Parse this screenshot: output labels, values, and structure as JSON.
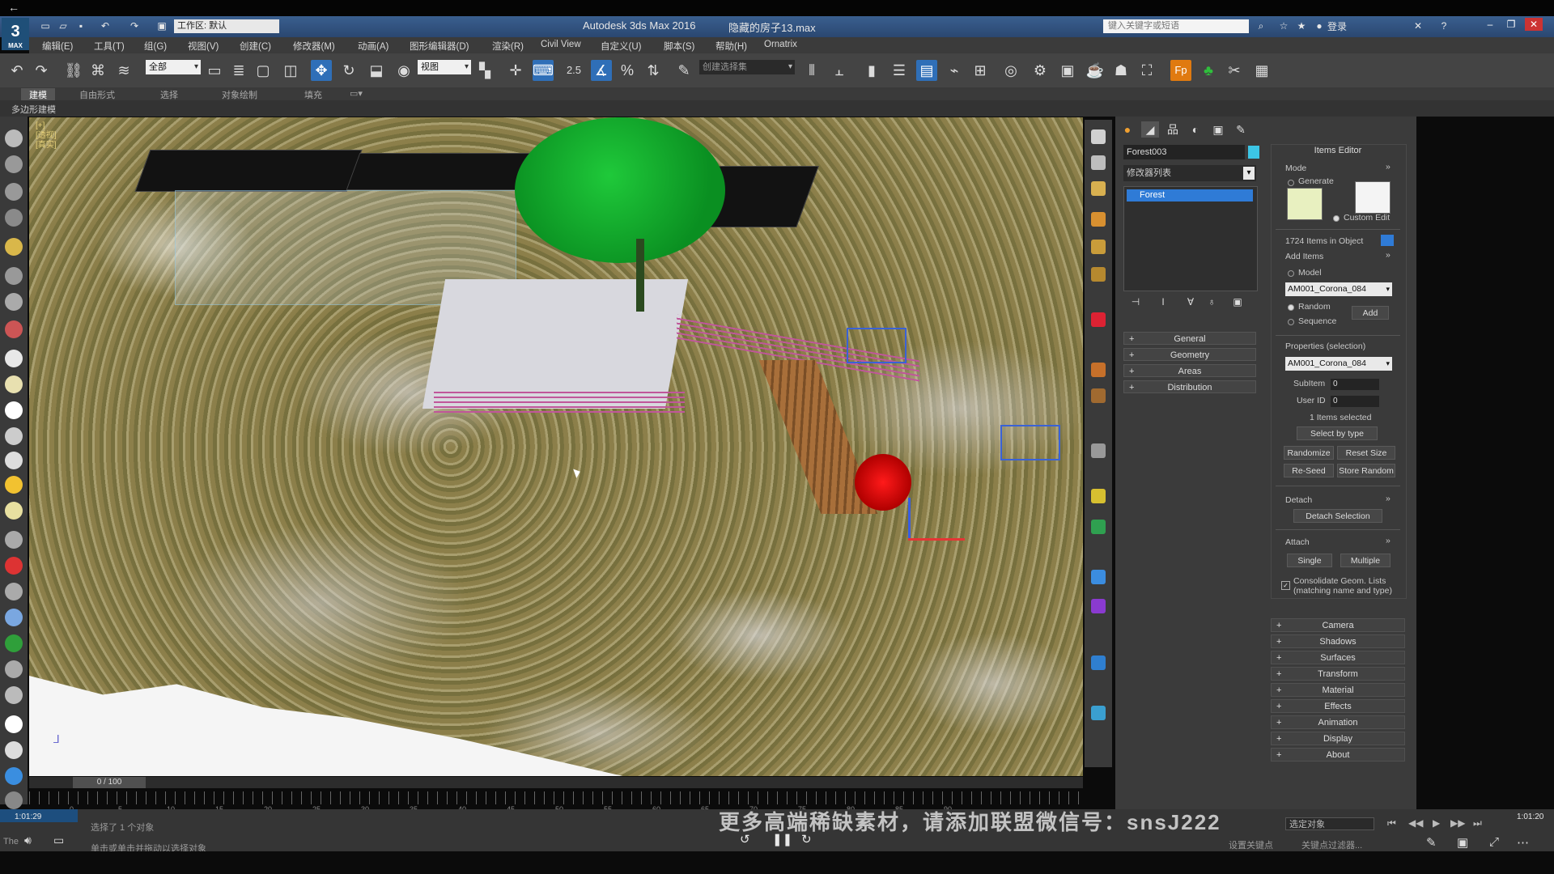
{
  "system": {
    "back_icon": "back-arrow-icon"
  },
  "titlebar": {
    "app_title": "Autodesk 3ds Max 2016",
    "doc_title": "隐藏的房子13.max",
    "workspace_label": "工作区: 默认",
    "search_placeholder": "键入关键字或短语",
    "login": "登录",
    "logo_text": "3",
    "logo_sub": "MAX"
  },
  "menu": [
    "编辑(E)",
    "工具(T)",
    "组(G)",
    "视图(V)",
    "创建(C)",
    "修改器(M)",
    "动画(A)",
    "图形编辑器(D)",
    "渲染(R)",
    "Civil View",
    "自定义(U)",
    "脚本(S)",
    "帮助(H)",
    "Ornatrix"
  ],
  "toolbar": {
    "selection_filter": "全部",
    "reference_coord": "视图",
    "named_selection": "创建选择集",
    "snap_label": "2.5"
  },
  "ribbon": {
    "tabs": [
      "建模",
      "自由形式",
      "选择",
      "对象绘制",
      "填充"
    ],
    "active_tab": "建模",
    "sub_label": "多边形建模"
  },
  "viewport": {
    "label_lines": [
      "[+]",
      "[透视]",
      "[真实]"
    ]
  },
  "timeline": {
    "frame_display": "0 / 100",
    "ticks": [
      "0",
      "5",
      "10",
      "15",
      "20",
      "25",
      "30",
      "35",
      "40",
      "45",
      "50",
      "55",
      "60",
      "65",
      "70",
      "75",
      "80",
      "85",
      "90"
    ]
  },
  "status": {
    "selected": "选择了 1 个对象",
    "prompt": "单击或单击并拖动以选择对象",
    "time_left": "1:01:29",
    "time_right": "1:01:20",
    "select_mode": "选定对象",
    "set_key": "设置关键点",
    "key_filters": "关键点过滤器...",
    "watermark": "更多高端稀缺素材，请添加联盟微信号：snsJ222",
    "left_label": "The"
  },
  "command_panel": {
    "object_name": "Forest003",
    "object_color": "#3cc6e6",
    "modifier_list": "修改器列表",
    "stack_item": "Forest",
    "rollouts": [
      "General",
      "Geometry",
      "Areas",
      "Distribution"
    ]
  },
  "items_editor": {
    "title": "Items Editor",
    "mode_label": "Mode",
    "generate": "Generate",
    "custom_edit": "Custom Edit",
    "items_count": "1724 Items in Object",
    "add_items": "Add Items",
    "model_label": "Model",
    "model_value": "AM001_Corona_084",
    "random": "Random",
    "sequence": "Sequence",
    "add_button": "Add",
    "properties_label": "Properties (selection)",
    "properties_value": "AM001_Corona_084",
    "subitem_label": "SubItem",
    "subitem_value": "0",
    "userid_label": "User ID",
    "userid_value": "0",
    "items_selected": "1 Items selected",
    "select_by_type": "Select by type",
    "randomize": "Randomize",
    "reset_size": "Reset Size",
    "reseed": "Re-Seed",
    "store_random": "Store Random",
    "detach_label": "Detach",
    "detach_selection": "Detach Selection",
    "attach_label": "Attach",
    "single": "Single",
    "multiple": "Multiple",
    "consolidate": "Consolidate Geom. Lists (matching name and type)",
    "rollouts": [
      "Camera",
      "Shadows",
      "Surfaces",
      "Transform",
      "Material",
      "Effects",
      "Animation",
      "Display",
      "About"
    ]
  }
}
